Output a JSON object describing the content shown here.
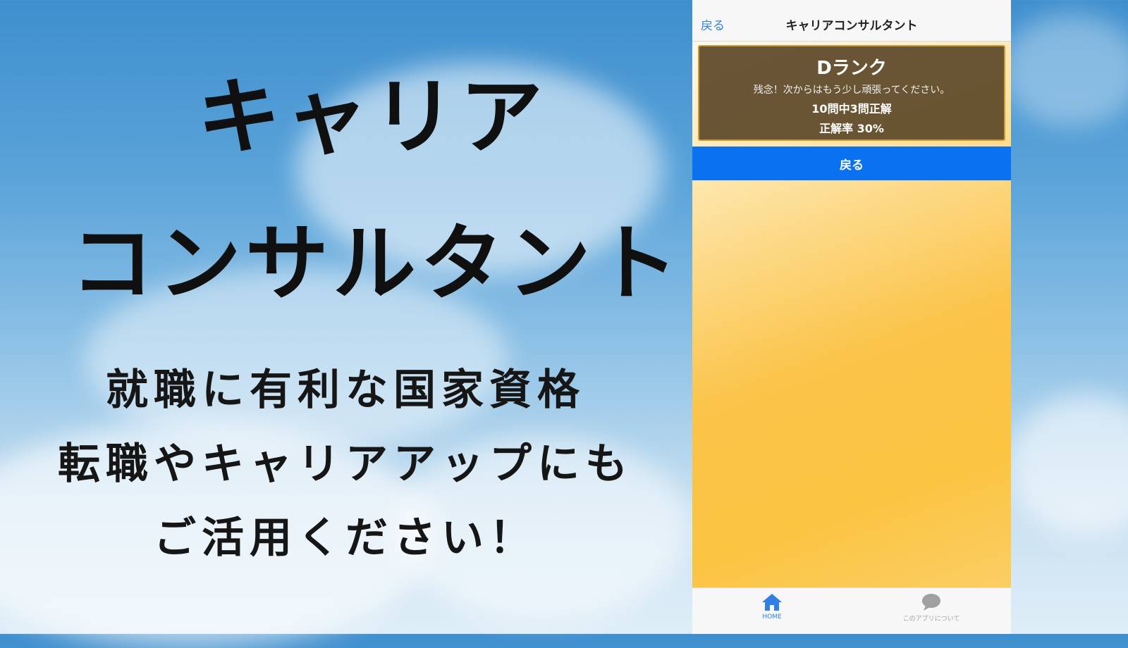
{
  "promo": {
    "title_line1": "キャリア",
    "title_line2": "コンサルタント",
    "subtitle_line1": "就職に有利な国家資格",
    "subtitle_line2": "転職やキャリアアップにも",
    "subtitle_line3": "ご活用ください！"
  },
  "app": {
    "nav": {
      "back_label": "戻る",
      "title": "キャリアコンサルタント"
    },
    "result": {
      "rank": "Dランク",
      "message": "残念！次からはもう少し頑張ってください。",
      "score": "10問中3問正解",
      "rate": "正解率 30%"
    },
    "back_button_label": "戻る",
    "tabs": [
      {
        "label": "HOME",
        "icon": "home-icon"
      },
      {
        "label": "このアプリについて",
        "icon": "chat-bubble-icon"
      }
    ]
  },
  "colors": {
    "accent_blue": "#0a72f0",
    "card_bg": "#5c4828",
    "card_border": "#c89a3a",
    "app_bg_orange": "#fbc441"
  }
}
